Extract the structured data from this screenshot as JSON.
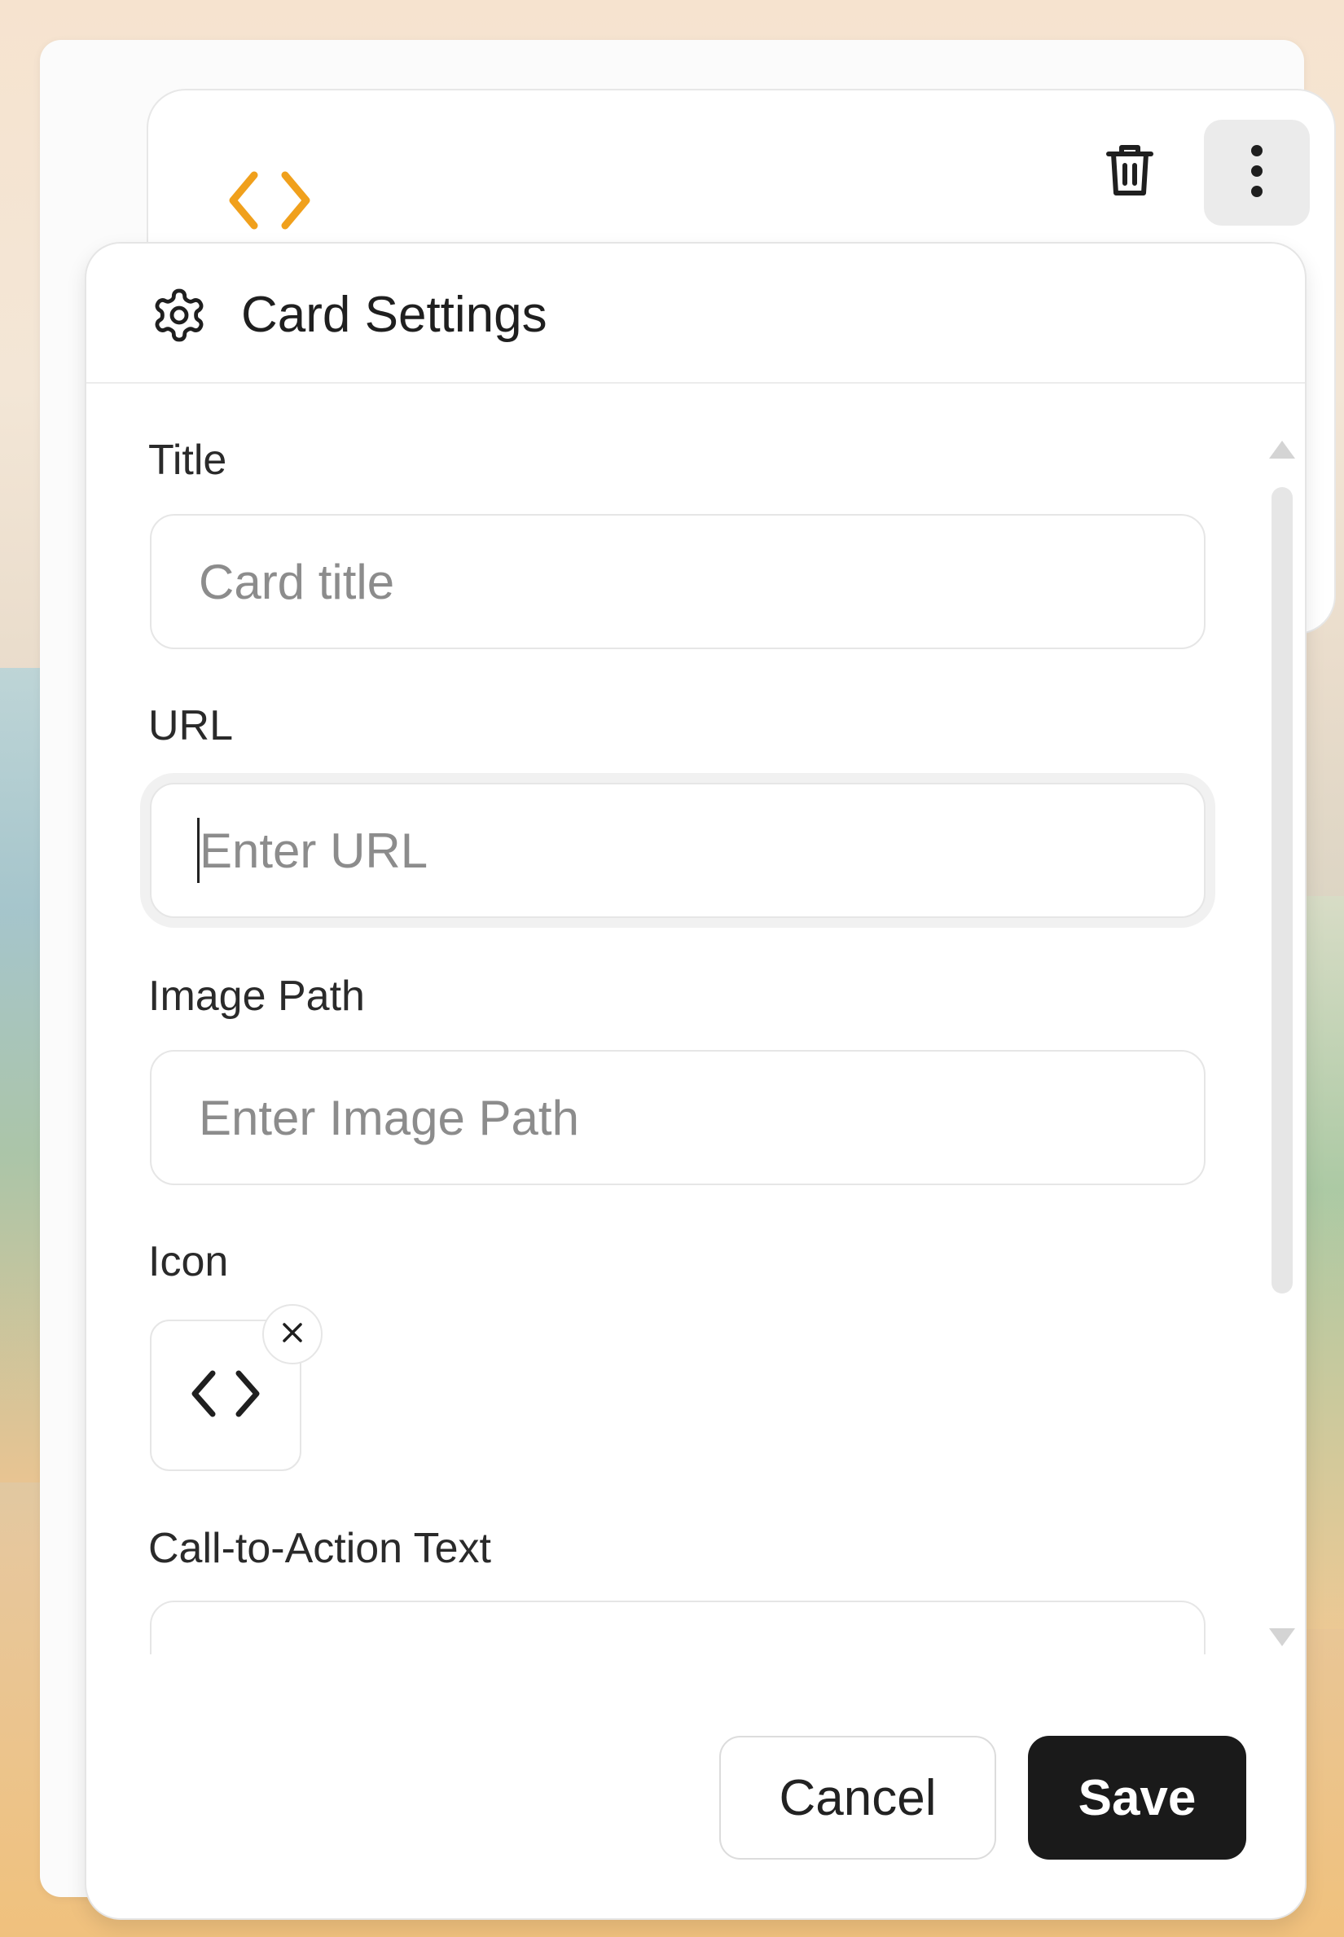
{
  "card": {
    "icon": "code-icon",
    "accent_color": "#f0a01c",
    "delete_icon": "trash-icon",
    "more_icon": "more-vertical-icon"
  },
  "dialog": {
    "header_icon": "gear-icon",
    "title": "Card Settings",
    "fields": {
      "title": {
        "label": "Title",
        "value": "",
        "placeholder": "Card title"
      },
      "url": {
        "label": "URL",
        "value": "",
        "placeholder": "Enter URL"
      },
      "image_path": {
        "label": "Image Path",
        "value": "",
        "placeholder": "Enter Image Path"
      },
      "icon": {
        "label": "Icon",
        "selected_icon": "code-icon",
        "remove_icon": "close-icon"
      },
      "cta": {
        "label": "Call-to-Action Text",
        "value": ""
      }
    },
    "buttons": {
      "cancel": "Cancel",
      "save": "Save"
    }
  }
}
